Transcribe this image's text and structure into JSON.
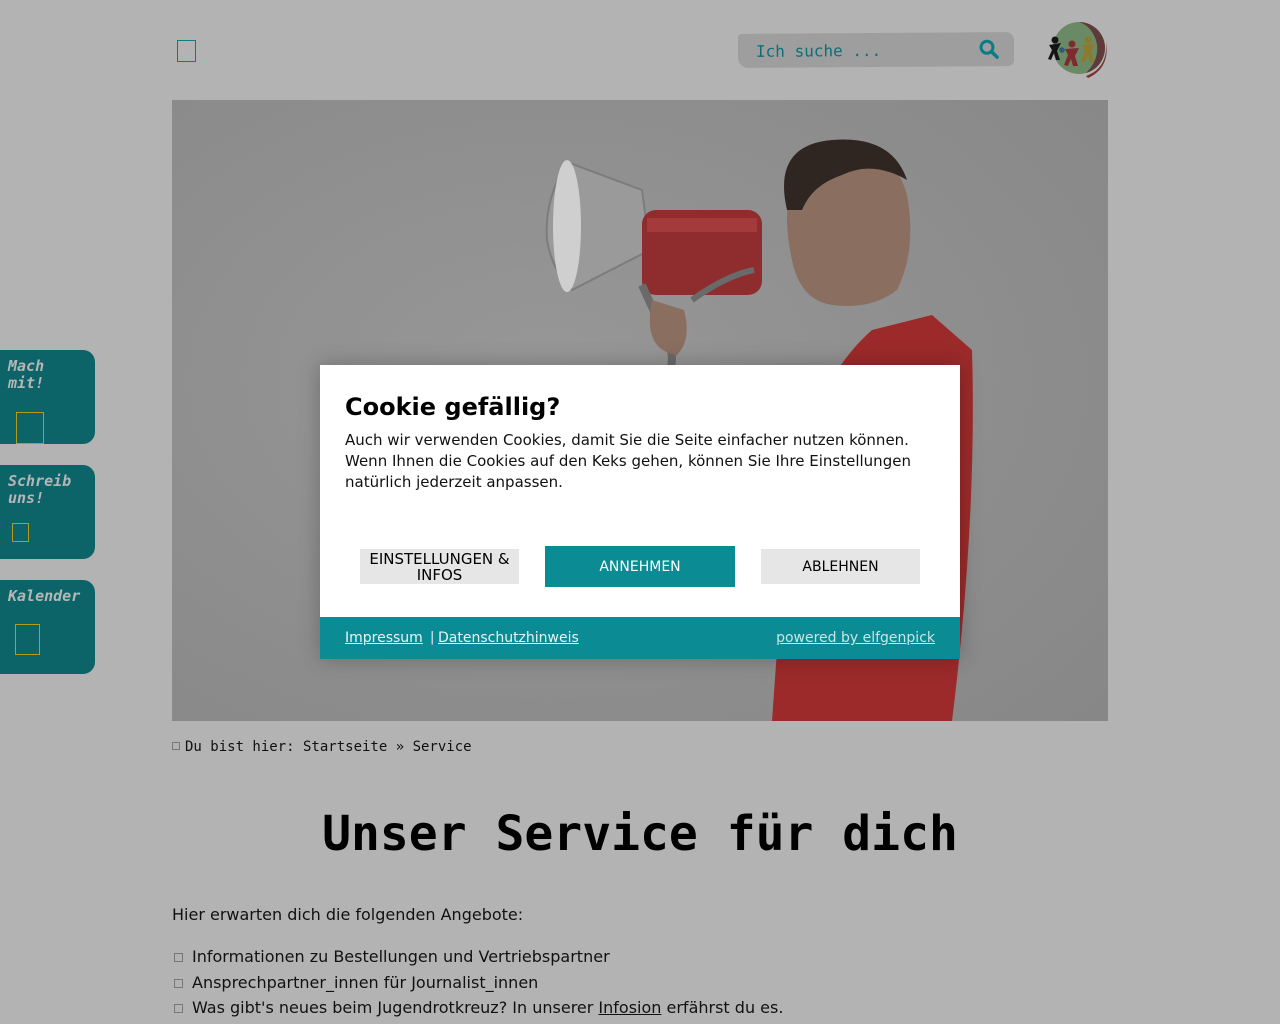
{
  "header": {
    "search_placeholder": "Ich suche ..."
  },
  "side_tabs": [
    {
      "label": "Mach\nmit!"
    },
    {
      "label": "Schreib\nuns!"
    },
    {
      "label": "Kalender"
    }
  ],
  "breadcrumb": {
    "text": "Du bist hier: Startseite » Service"
  },
  "main": {
    "title": "Unser Service für dich",
    "intro": "Hier erwarten dich die folgenden Angebote:",
    "offers": [
      {
        "text": "Informationen zu Bestellungen und Vertriebspartner"
      },
      {
        "text": "Ansprechpartner_innen für Journalist_innen"
      },
      {
        "before": "Was gibt's neues beim Jugendrotkreuz? In unserer ",
        "link": "Infosion",
        "after": " erfährst du es."
      }
    ]
  },
  "cookie": {
    "title": "Cookie gefällig?",
    "text": "Auch wir verwenden Cookies, damit Sie die Seite einfacher nutzen können. Wenn Ihnen die Cookies auf den Keks gehen, können Sie Ihre Einstellungen natürlich jederzeit anpassen.",
    "btn_settings": "EINSTELLUNGEN & INFOS",
    "btn_accept": "ANNEHMEN",
    "btn_decline": "ABLEHNEN",
    "footer": {
      "impressum": "Impressum",
      "separator": "|",
      "datenschutz": "Datenschutzhinweis",
      "powered": "powered by elfgenpick"
    }
  },
  "colors": {
    "teal": "#0b8b93",
    "tab_teal": "#0c6469",
    "overlay_gray": "#b3b3b3",
    "hoodie_red": "#9c2a2a"
  }
}
